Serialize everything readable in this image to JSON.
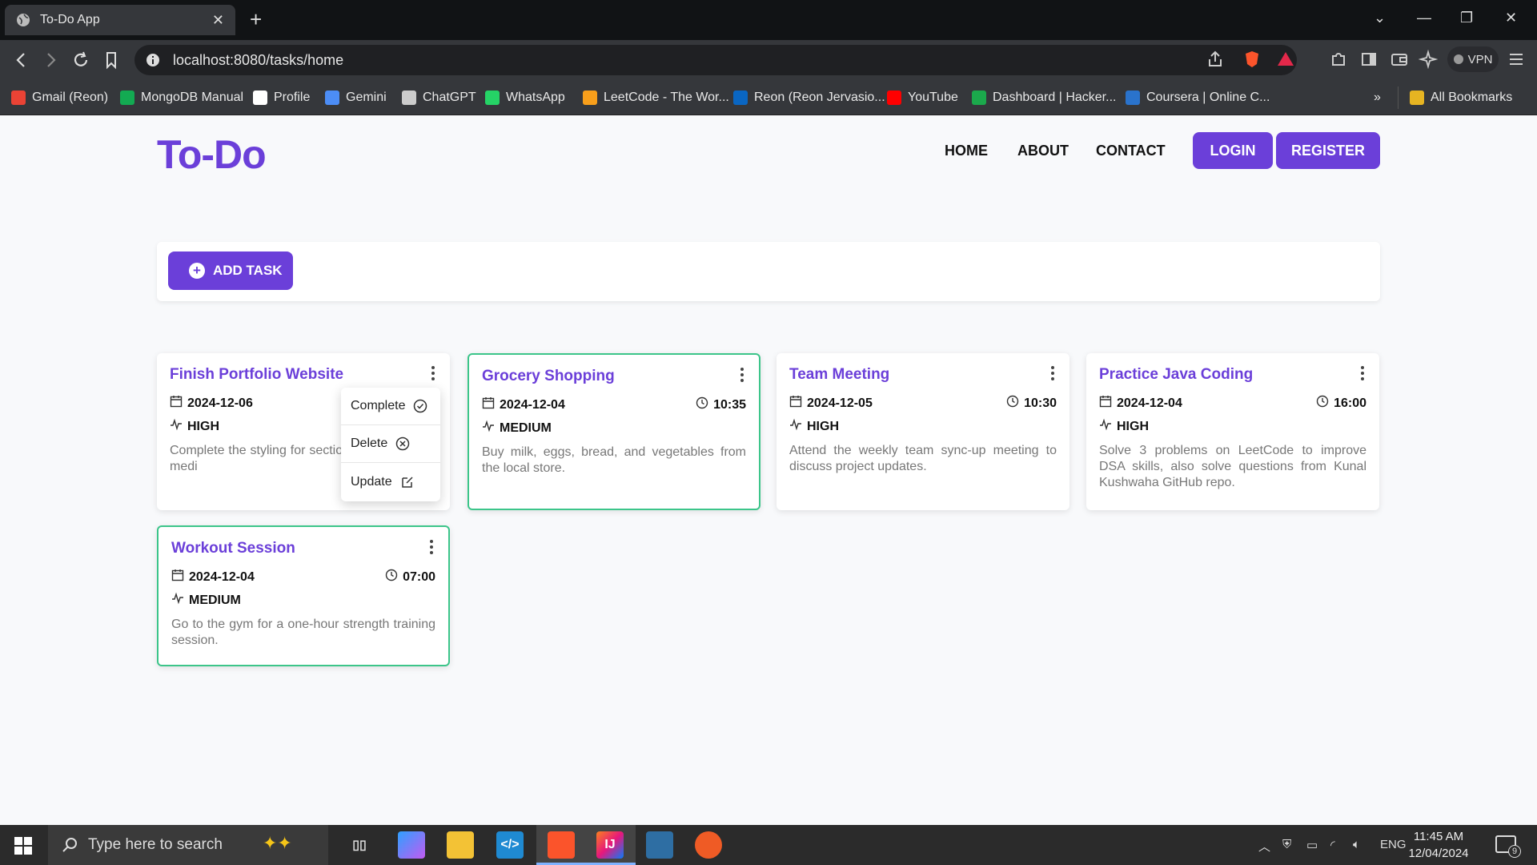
{
  "browser": {
    "tab_title": "To-Do App",
    "url": "localhost:8080/tasks/home",
    "vpn_label": "VPN",
    "bookmarks": [
      {
        "label": "Gmail (Reon)",
        "icon": "gmail-icon",
        "color": "#ea4335"
      },
      {
        "label": "MongoDB Manual",
        "icon": "mongodb-leaf-icon",
        "color": "#13aa52"
      },
      {
        "label": "Profile",
        "icon": "github-icon",
        "color": "#ffffff"
      },
      {
        "label": "Gemini",
        "icon": "gemini-sparkle-icon",
        "color": "#4c8df6"
      },
      {
        "label": "ChatGPT",
        "icon": "chatgpt-icon",
        "color": "#cccccc"
      },
      {
        "label": "WhatsApp",
        "icon": "whatsapp-icon",
        "color": "#25d366"
      },
      {
        "label": "LeetCode - The Wor...",
        "icon": "leetcode-icon",
        "color": "#f89f1b"
      },
      {
        "label": "Reon (Reon Jervasio...",
        "icon": "linkedin-icon",
        "color": "#0a66c2"
      },
      {
        "label": "YouTube",
        "icon": "youtube-icon",
        "color": "#ff0000"
      },
      {
        "label": "Dashboard | Hacker...",
        "icon": "hackerrank-icon",
        "color": "#1ba94c"
      },
      {
        "label": "Coursera | Online C...",
        "icon": "coursera-icon",
        "color": "#2a73cc"
      }
    ],
    "all_bookmarks": "All Bookmarks"
  },
  "header": {
    "brand": "To-Do",
    "nav": [
      "HOME",
      "ABOUT",
      "CONTACT"
    ],
    "login": "LOGIN",
    "register": "REGISTER"
  },
  "toolbar": {
    "add_task": "ADD TASK"
  },
  "tasks": [
    {
      "title": "Finish Portfolio Website",
      "date": "2024-12-06",
      "time": "",
      "priority": "HIGH",
      "description": "Complete the styling for section and add social medi",
      "highlighted": false
    },
    {
      "title": "Grocery Shopping",
      "date": "2024-12-04",
      "time": "10:35",
      "priority": "MEDIUM",
      "description": "Buy milk, eggs, bread, and vegetables from the local store.",
      "highlighted": true
    },
    {
      "title": "Team Meeting",
      "date": "2024-12-05",
      "time": "10:30",
      "priority": "HIGH",
      "description": "Attend the weekly team sync-up meeting to discuss project updates.",
      "highlighted": false
    },
    {
      "title": "Practice Java Coding",
      "date": "2024-12-04",
      "time": "16:00",
      "priority": "HIGH",
      "description": "Solve 3 problems on LeetCode to improve DSA skills, also solve questions from Kunal Kushwaha GitHub repo.",
      "highlighted": false
    },
    {
      "title": "Workout Session",
      "date": "2024-12-04",
      "time": "07:00",
      "priority": "MEDIUM",
      "description": "Go to the gym for a one-hour strength training session.",
      "highlighted": true
    }
  ],
  "context_menu": {
    "items": [
      {
        "label": "Complete",
        "icon": "check-circle-icon"
      },
      {
        "label": "Delete",
        "icon": "x-circle-icon"
      },
      {
        "label": "Update",
        "icon": "edit-icon"
      }
    ]
  },
  "taskbar": {
    "search_placeholder": "Type here to search",
    "language": "ENG",
    "time": "11:45 AM",
    "date": "12/04/2024",
    "notification_count": "9"
  },
  "colors": {
    "accent": "#6b3fd9",
    "highlight_border": "#3cc58a"
  }
}
